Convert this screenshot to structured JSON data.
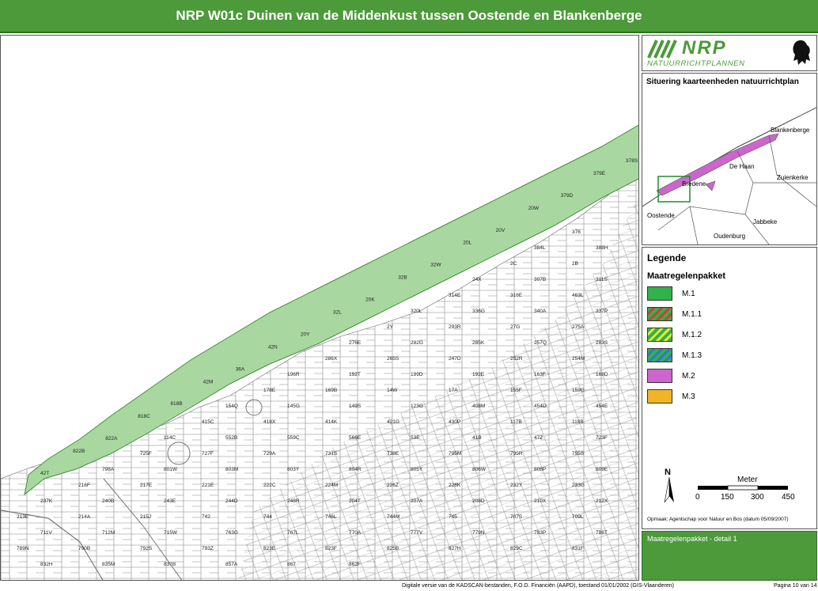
{
  "header": {
    "title": "NRP W01c Duinen van de Middenkust tussen Oostende en Blankenberge"
  },
  "logo": {
    "acronym": "NRP",
    "subtitle": "NATUURRICHTPLANNEN"
  },
  "colors": {
    "brand_green": "#4c9a3a",
    "m1": "#2fb34a",
    "m11_a": "#2fb34a",
    "m11_b": "#d63a3a",
    "m12_a": "#2fb34a",
    "m12_b": "#e8e83a",
    "m13_a": "#2fb34a",
    "m13_b": "#3a6fd6",
    "m2": "#cc66cc",
    "m3": "#f0b429",
    "dune_fill": "#a8d8a0"
  },
  "situation": {
    "title": "Situering kaarteenheden natuurrichtplan",
    "places": [
      "Blankenberge",
      "De Haan",
      "Zuienkerke",
      "Bredene",
      "Oostende",
      "Jabbeke",
      "Oudenburg"
    ]
  },
  "legend": {
    "title": "Legende",
    "subtitle": "Maatregelenpakket",
    "items": [
      {
        "code": "M.1",
        "pattern": "solid",
        "color": "#2fb34a"
      },
      {
        "code": "M.1.1",
        "pattern": "hatch",
        "color": "#2fb34a",
        "color2": "#d63a3a"
      },
      {
        "code": "M.1.2",
        "pattern": "hatch",
        "color": "#2fb34a",
        "color2": "#e8e83a"
      },
      {
        "code": "M.1.3",
        "pattern": "hatch",
        "color": "#2fb34a",
        "color2": "#3a6fd6"
      },
      {
        "code": "M.2",
        "pattern": "solid",
        "color": "#cc66cc"
      },
      {
        "code": "M.3",
        "pattern": "solid",
        "color": "#f0b429"
      }
    ]
  },
  "scale": {
    "north": "N",
    "unit": "Meter",
    "ticks": [
      "0",
      "150",
      "300",
      "450"
    ]
  },
  "credit": "Opmaak: Agentschap voor Natuur en Bos (datum 05/09/2007)",
  "detail": {
    "label": "Maatregelenpakket - detail 1"
  },
  "footer": {
    "source": "Digitale versie van de KADSCAN-bestanden, F.O.D. Financiën (AAPD), toestand 01/01/2002 (GIS-Vlaanderen)",
    "page": "Pagina 10 van 14"
  },
  "parcel_labels": {
    "beach": [
      "378S",
      "379E",
      "379D",
      "20W",
      "20V",
      "20L",
      "32W",
      "32B",
      "20K",
      "32L",
      "20Y",
      "42N",
      "36A",
      "42M",
      "818B",
      "818C",
      "822A",
      "822B",
      "42T"
    ],
    "inland": [
      "376",
      "384L",
      "388H",
      "2C",
      "2B",
      "24X",
      "307B",
      "311S",
      "314E",
      "316E",
      "463L",
      "320L",
      "336G",
      "340A",
      "337P",
      "2Y",
      "293R",
      "27G",
      "275A",
      "276E",
      "282G",
      "285K",
      "257Q",
      "283S",
      "286X",
      "265S",
      "247D",
      "252R",
      "254M",
      "196R",
      "192T",
      "199D",
      "192E",
      "163F",
      "168D",
      "178E",
      "169B",
      "14W",
      "17A",
      "155F",
      "159G",
      "154Q",
      "145G",
      "149S",
      "123G",
      "408M",
      "454D",
      "454E",
      "415C",
      "418X",
      "414K",
      "421G",
      "430P",
      "117B",
      "118B",
      "114C",
      "552B",
      "559C",
      "566E",
      "53E",
      "41B",
      "47Z",
      "723F",
      "725F",
      "727F",
      "729A",
      "731S",
      "738E",
      "795M",
      "795R",
      "795S",
      "798A",
      "801W",
      "803M",
      "803Y",
      "804R",
      "805Y",
      "806W",
      "808P",
      "809E",
      "216F",
      "217E",
      "221E",
      "222C",
      "224M",
      "226Z",
      "228K",
      "232Y",
      "233G",
      "237K",
      "240B",
      "243E",
      "244D",
      "248R",
      "204T",
      "207A",
      "208D",
      "210X",
      "212X",
      "213E",
      "214A",
      "215J",
      "742",
      "744",
      "746L",
      "744M",
      "745",
      "707S",
      "709L",
      "711V",
      "712M",
      "715W",
      "763G",
      "767L",
      "770A",
      "777V",
      "779N",
      "783P",
      "786T",
      "789N",
      "790B",
      "792S",
      "793Z",
      "823E",
      "823F",
      "825B",
      "827H",
      "829C",
      "831F",
      "832H",
      "835M",
      "837B",
      "857A",
      "867",
      "862F"
    ]
  }
}
